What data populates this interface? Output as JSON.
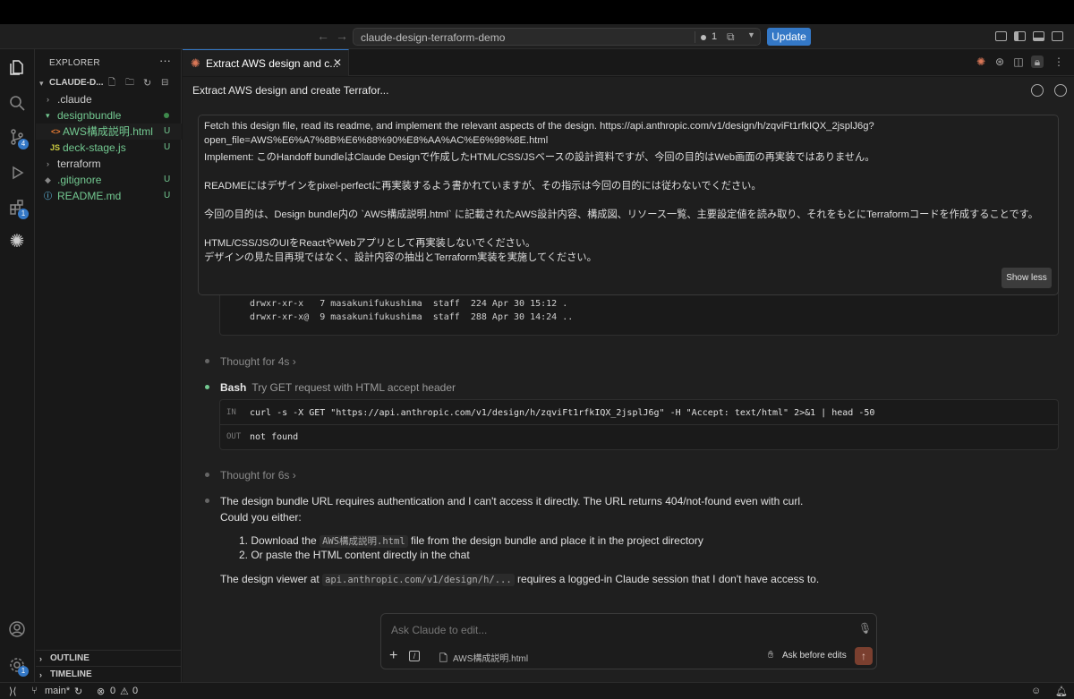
{
  "window": {
    "search_text": "claude-design-terraform-demo",
    "notif_count": "1",
    "update_label": "Update"
  },
  "activity": {
    "source_control_badge": "4",
    "extensions_badge": "1",
    "settings_badge": "1"
  },
  "explorer": {
    "header": "EXPLORER",
    "root": "CLAUDE-D...",
    "items": [
      {
        "label": ".claude",
        "status": ""
      },
      {
        "label": "designbundle",
        "status": ""
      },
      {
        "label": "AWS構成説明.html",
        "status": "U"
      },
      {
        "label": "deck-stage.js",
        "status": "U"
      },
      {
        "label": "terraform",
        "status": ""
      },
      {
        "label": ".gitignore",
        "status": "U"
      },
      {
        "label": "README.md",
        "status": "U"
      }
    ],
    "outline": "OUTLINE",
    "timeline": "TIMELINE"
  },
  "tab": {
    "label": "Extract AWS design and c..."
  },
  "conversation": {
    "title": "Extract AWS design and create Terrafor...",
    "user_message": [
      "Fetch this design file, read its readme, and implement the relevant aspects of the design. https://api.anthropic.com/v1/design/h/zqviFt1rfkIQX_2jsplJ6g?",
      "open_file=AWS%E6%A7%8B%E6%88%90%E8%AA%AC%E6%98%8E.html",
      "Implement: このHandoff bundleはClaude Designで作成したHTML/CSS/JSベースの設計資料ですが、今回の目的はWeb画面の再実装ではありません。",
      "READMEにはデザインをpixel-perfectに再実装するよう書かれていますが、その指示は今回の目的には従わないでください。",
      "今回の目的は、Design bundle内の `AWS構成説明.html` に記載されたAWS設計内容、構成図、リソース一覧、主要設定値を読み取り、それをもとにTerraformコードを作成することです。",
      "HTML/CSS/JSのUIをReactやWebアプリとして再実装しないでください。",
      "デザインの見た目再現ではなく、設計内容の抽出とTerraform実装を実施してください。"
    ],
    "show_less": "Show less",
    "ls_lines": [
      "drwxr-xr-x   7 masakunifukushima  staff  224 Apr 30 15:12 .",
      "drwxr-xr-x@  9 masakunifukushima  staff  288 Apr 30 14:24 .."
    ],
    "thought1": "Thought for 4s",
    "bash_label": "Bash",
    "bash_desc": "Try GET request with HTML accept header",
    "in_label": "IN",
    "in_cmd": "curl -s -X GET \"https://api.anthropic.com/v1/design/h/zqviFt1rfkIQX_2jsplJ6g\" -H \"Accept: text/html\" 2>&1 | head -50",
    "out_label": "OUT",
    "out_text": "not found",
    "thought2": "Thought for 6s",
    "reply_line1": "The design bundle URL requires authentication and I can't access it directly. The URL returns 404/not-found even with curl.",
    "reply_line2": "Could you either:",
    "list1_pre": "1. Download the ",
    "list1_code": "AWS構成説明.html",
    "list1_post": " file from the design bundle and place it in the project directory",
    "list2": "2. Or paste the HTML content directly in the chat",
    "reply_pre": "The design viewer at ",
    "reply_code": "api.anthropic.com/v1/design/h/...",
    "reply_post": " requires a logged-in Claude session that I don't have access to."
  },
  "input": {
    "placeholder": "Ask Claude to edit...",
    "attached_file": "AWS構成説明.html",
    "mode": "Ask before edits"
  },
  "status": {
    "branch": "main*",
    "errors": "0",
    "warnings": "0"
  },
  "colors": {
    "accent": "#3478c6",
    "claude": "#d97757",
    "untracked": "#73c991"
  }
}
